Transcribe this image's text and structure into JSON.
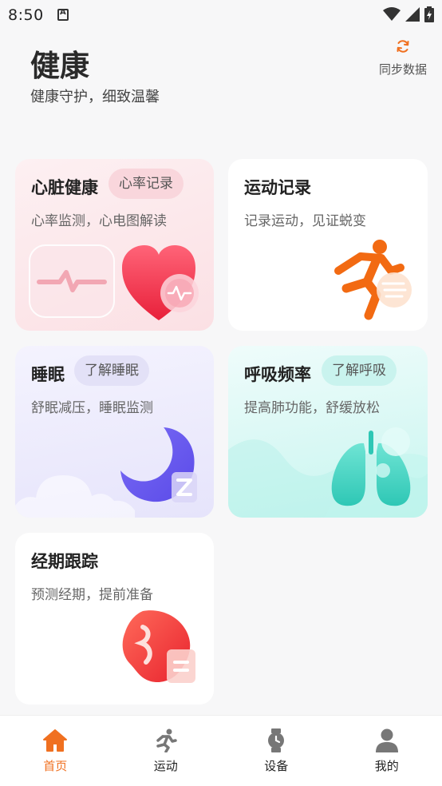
{
  "status_bar": {
    "time": "8:50"
  },
  "header": {
    "title": "健康",
    "subtitle": "健康守护，细致温馨",
    "sync_label": "同步数据"
  },
  "cards": {
    "heart": {
      "title": "心脏健康",
      "tag": "心率记录",
      "desc": "心率监测，心电图解读"
    },
    "sport": {
      "title": "运动记录",
      "desc": "记录运动，见证蜕变"
    },
    "sleep": {
      "title": "睡眠",
      "tag": "了解睡眠",
      "desc": "舒眠减压，睡眠监测"
    },
    "breath": {
      "title": "呼吸频率",
      "tag": "了解呼吸",
      "desc": "提高肺功能，舒缓放松"
    },
    "period": {
      "title": "经期跟踪",
      "desc": "预测经期，提前准备"
    }
  },
  "nav": {
    "items": [
      {
        "label": "首页",
        "icon": "home-icon",
        "active": true
      },
      {
        "label": "运动",
        "icon": "running-icon",
        "active": false
      },
      {
        "label": "设备",
        "icon": "watch-icon",
        "active": false
      },
      {
        "label": "我的",
        "icon": "user-icon",
        "active": false
      }
    ]
  },
  "colors": {
    "accent": "#f07020",
    "heart": "#ef3f55",
    "sleep": "#6a5cf0",
    "breath": "#3fd6c4",
    "sport": "#f26a12",
    "period": "#ef3b3b"
  }
}
